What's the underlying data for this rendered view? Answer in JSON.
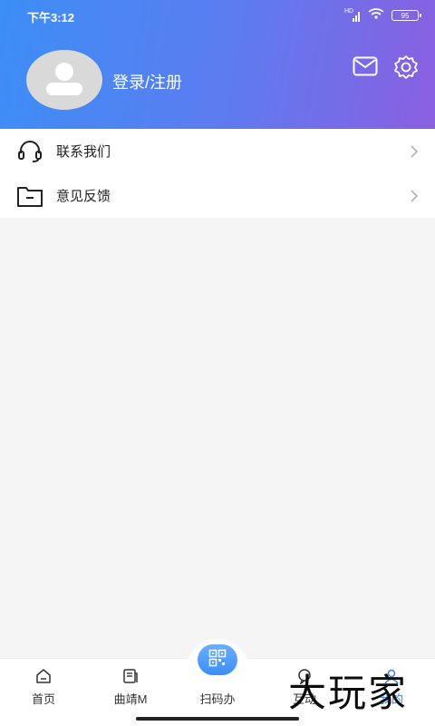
{
  "status_bar": {
    "time": "下午3:12",
    "hd": "HD",
    "battery": "95"
  },
  "profile": {
    "login_label": "登录/注册"
  },
  "menu": {
    "items": [
      {
        "label": "联系我们",
        "icon": "headset-icon"
      },
      {
        "label": "意见反馈",
        "icon": "feedback-folder-icon"
      }
    ]
  },
  "tabbar": {
    "tabs": [
      {
        "label": "首页",
        "icon": "home-icon"
      },
      {
        "label": "曲靖M",
        "icon": "news-icon"
      },
      {
        "label": "扫码办",
        "icon": "qr-code-icon"
      },
      {
        "label": "互动",
        "icon": "interact-icon"
      },
      {
        "label": "我的",
        "icon": "profile-icon"
      }
    ]
  },
  "watermark": {
    "text": "大玩家"
  },
  "colors": {
    "accent": "#3d7de8",
    "header_start": "#3d8ef7",
    "header_end": "#8a5fe0"
  }
}
